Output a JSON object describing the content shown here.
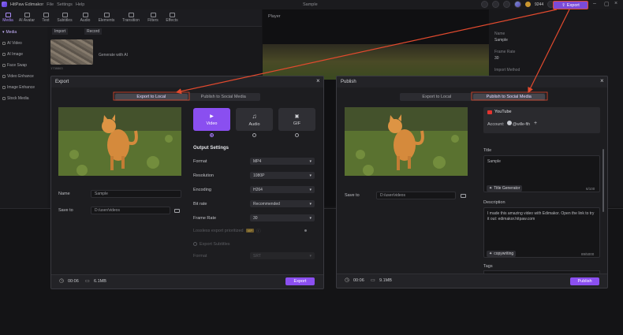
{
  "app": {
    "name": "HitPaw Edimakor",
    "menus": [
      "File",
      "Settings",
      "Help"
    ],
    "doc_title": "Sample",
    "credits": "9244",
    "export_label": "Export"
  },
  "toolbar": [
    "Media",
    "AI Avatar",
    "Text",
    "Subtitles",
    "Audio",
    "Elements",
    "Transition",
    "Filters",
    "Effects"
  ],
  "sidebar": [
    "Media",
    "AI Video",
    "AI Image",
    "Face Swap",
    "Video Enhance",
    "Image Enhance",
    "Stock Media"
  ],
  "media": {
    "import_label": "Import",
    "record_label": "Record",
    "generate_label": "Generate with AI",
    "thumb_caption": "1738863"
  },
  "player": {
    "label": "Player"
  },
  "right_panel": {
    "labels": [
      "Name",
      "Sample",
      "Frame Rate",
      "30",
      "Import Method"
    ]
  },
  "export_dialog": {
    "title": "Export",
    "tabs": [
      "Export to Local",
      "Publish to Social Media"
    ],
    "active_tab": 0,
    "name_label": "Name",
    "name_value": "Sample",
    "saveto_label": "Save to",
    "saveto_value": "D:/user/videos",
    "formats": [
      {
        "label": "Video",
        "icon": "video-format-icon",
        "selected": true
      },
      {
        "label": "Audio",
        "icon": "music-note-icon",
        "selected": false
      },
      {
        "label": "GIF",
        "icon": "gif-icon",
        "selected": false
      }
    ],
    "video_badge": "MP4",
    "gif_badge": "GIF",
    "output_settings_label": "Output Settings",
    "settings": [
      {
        "label": "Format",
        "value": "MP4"
      },
      {
        "label": "Resolution",
        "value": "1080P"
      },
      {
        "label": "Encoding",
        "value": "H264"
      },
      {
        "label": "Bit rate",
        "value": "Recommended"
      },
      {
        "label": "Frame Rate",
        "value": "30"
      }
    ],
    "gpu_label": "Lossless export prioritized",
    "gpu_badge": "VIP",
    "subtitles_label": "Export Subtitles",
    "subtitle_format_label": "Format",
    "subtitle_format_value": "SRT",
    "duration": "00:06",
    "size": "6.1MB",
    "export_button": "Export"
  },
  "publish_dialog": {
    "title": "Publish",
    "tabs": [
      "Export to Local",
      "Publish to Social Media"
    ],
    "active_tab": 1,
    "platform": "YouTube",
    "account_label": "Account:",
    "account_name": "@wille-fth",
    "add_account": "+",
    "saveto_label": "Save to",
    "saveto_value": "D:/user/videos",
    "title_label": "Title",
    "title_value": "Sample",
    "title_gen_button": "Title Generator",
    "title_count": "6/100",
    "desc_label": "Description",
    "desc_value": "I made this amazing video with Edimakor. Open the link to try it out: edimakor.hitpaw.com",
    "copywriting_button": "copywriting",
    "desc_count": "89/5000",
    "tags_label": "Tags",
    "duration": "00:06",
    "size": "9.1MB",
    "publish_button": "Publish"
  },
  "colors": {
    "accent": "#8b4ff0",
    "annotation": "#e24a2e"
  }
}
